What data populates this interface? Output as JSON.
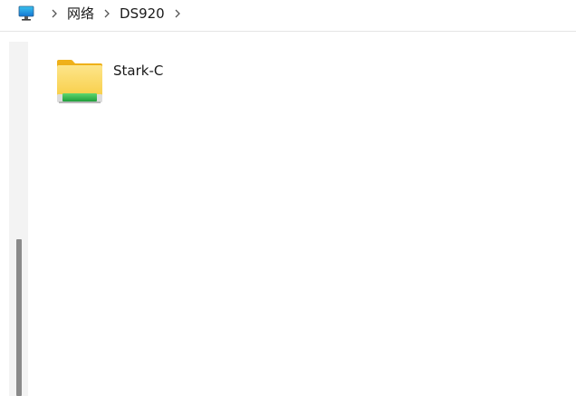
{
  "breadcrumb": {
    "root_icon": "this-pc-monitor-icon",
    "separator_icon": "chevron-right-icon",
    "items": [
      {
        "label": "网络"
      },
      {
        "label": "DS920"
      }
    ]
  },
  "content": {
    "items": [
      {
        "name": "Stark-C",
        "icon": "network-share-folder-icon"
      }
    ]
  },
  "colors": {
    "folder_yellow": "#f9c83c",
    "share_green": "#2fb84c",
    "scroll_thumb": "#8a8a8a",
    "nav_pane": "#f3f3f3"
  }
}
